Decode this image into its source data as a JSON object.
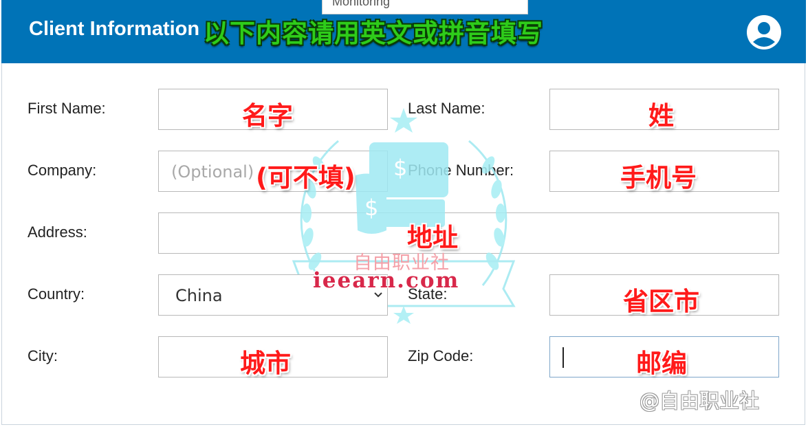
{
  "header": {
    "title": "Client Information",
    "overlay_note": "以下内容请用英文或拼音填写",
    "popup_tab": "Monitoring"
  },
  "form": {
    "first_name": {
      "label": "First Name:",
      "note": "名字"
    },
    "last_name": {
      "label": "Last Name:",
      "note": "姓"
    },
    "company": {
      "label": "Company:",
      "placeholder": "(Optional)",
      "note": "(可不填)"
    },
    "phone": {
      "label": "Phone Number:",
      "note": "手机号"
    },
    "address": {
      "label": "Address:",
      "note": "地址"
    },
    "country": {
      "label": "Country:",
      "selected": "China"
    },
    "state": {
      "label": "State:",
      "note": "省区市"
    },
    "city": {
      "label": "City:",
      "note": "城市"
    },
    "zip": {
      "label": "Zip Code:",
      "note": "邮编"
    }
  },
  "watermark": {
    "site_cn": "自由职业社",
    "site_url": "ieearn.com",
    "corner": "@自由职业社"
  },
  "colors": {
    "header_bg": "#0073b7",
    "overlay_red": "#ff1a1a",
    "overlay_green": "#2ecc1a"
  }
}
